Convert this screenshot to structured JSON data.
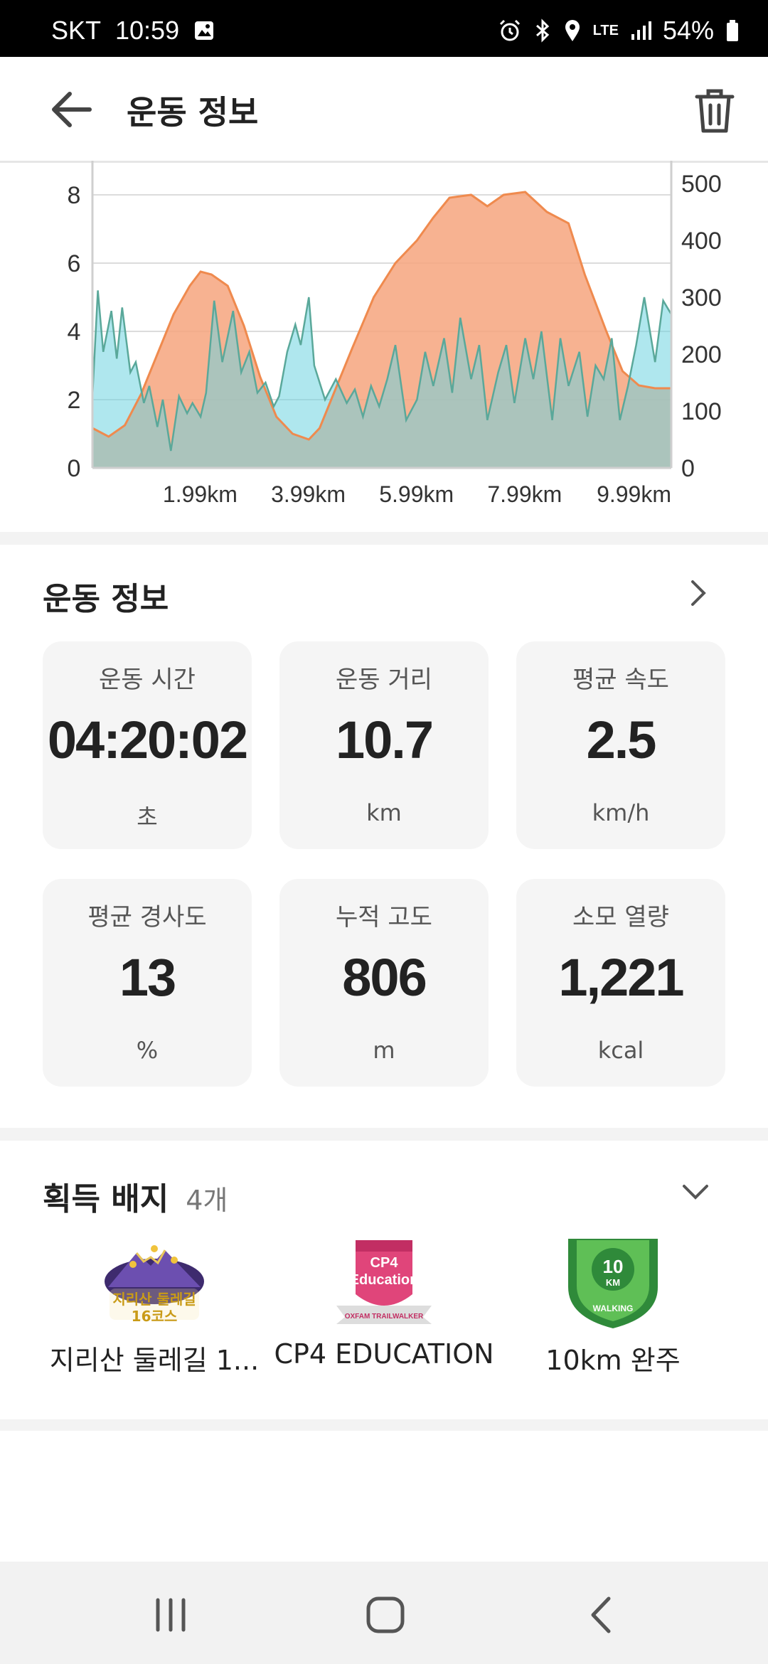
{
  "status": {
    "carrier": "SKT",
    "time": "10:59",
    "network": "LTE",
    "battery": "54%"
  },
  "header": {
    "title": "운동 정보"
  },
  "chart_data": {
    "type": "area",
    "x_tick_labels": [
      "1.99km",
      "3.99km",
      "5.99km",
      "7.99km",
      "9.99km"
    ],
    "x_range_km": [
      0,
      10.7
    ],
    "y_left": {
      "ticks": [
        0,
        2,
        4,
        6,
        8
      ],
      "range": [
        0,
        9
      ]
    },
    "y_right": {
      "ticks": [
        0,
        100,
        200,
        300,
        400,
        500
      ],
      "range": [
        0,
        540
      ]
    },
    "grid": true,
    "series": [
      {
        "axis": "right",
        "color": "#f6a57e",
        "x_km": [
          0,
          0.3,
          0.6,
          0.9,
          1.2,
          1.5,
          1.8,
          2.0,
          2.2,
          2.5,
          2.8,
          3.1,
          3.4,
          3.7,
          4.0,
          4.2,
          4.5,
          4.8,
          5.2,
          5.6,
          6.0,
          6.3,
          6.6,
          7.0,
          7.3,
          7.6,
          8.0,
          8.4,
          8.8,
          9.1,
          9.5,
          9.8,
          10.1,
          10.4,
          10.7
        ],
        "values": [
          70,
          55,
          75,
          130,
          200,
          270,
          320,
          345,
          340,
          320,
          250,
          160,
          90,
          60,
          50,
          70,
          140,
          210,
          300,
          360,
          400,
          440,
          475,
          480,
          460,
          480,
          485,
          450,
          430,
          340,
          240,
          170,
          145,
          140,
          140
        ]
      },
      {
        "axis": "left",
        "color": "#6ed4e0",
        "x_km": [
          0,
          0.1,
          0.2,
          0.35,
          0.45,
          0.55,
          0.7,
          0.8,
          0.95,
          1.05,
          1.2,
          1.3,
          1.45,
          1.6,
          1.75,
          1.85,
          2.0,
          2.1,
          2.25,
          2.4,
          2.6,
          2.75,
          2.9,
          3.05,
          3.2,
          3.35,
          3.45,
          3.6,
          3.75,
          3.85,
          4.0,
          4.1,
          4.3,
          4.5,
          4.7,
          4.85,
          5.0,
          5.15,
          5.3,
          5.45,
          5.6,
          5.8,
          6.0,
          6.15,
          6.3,
          6.5,
          6.65,
          6.8,
          7.0,
          7.15,
          7.3,
          7.5,
          7.65,
          7.8,
          8.0,
          8.15,
          8.3,
          8.5,
          8.65,
          8.8,
          9.0,
          9.15,
          9.3,
          9.45,
          9.6,
          9.75,
          9.9,
          10.05,
          10.2,
          10.4,
          10.55,
          10.7
        ],
        "values": [
          2.1,
          5.2,
          3.4,
          4.6,
          3.2,
          4.7,
          2.8,
          3.1,
          1.9,
          2.4,
          1.2,
          2.0,
          0.5,
          2.1,
          1.6,
          1.9,
          1.5,
          2.2,
          4.9,
          3.1,
          4.6,
          2.8,
          3.4,
          2.2,
          2.5,
          1.8,
          2.1,
          3.4,
          4.2,
          3.6,
          5.0,
          3.0,
          2.0,
          2.6,
          1.9,
          2.3,
          1.5,
          2.4,
          1.8,
          2.6,
          3.6,
          1.4,
          2.0,
          3.4,
          2.4,
          3.8,
          2.2,
          4.4,
          2.6,
          3.6,
          1.4,
          2.8,
          3.6,
          1.9,
          3.8,
          2.6,
          4.0,
          1.4,
          3.8,
          2.4,
          3.4,
          1.5,
          3.0,
          2.6,
          3.8,
          1.4,
          2.4,
          3.6,
          5.0,
          3.1,
          4.9,
          4.5
        ]
      }
    ]
  },
  "summary": {
    "title": "운동 정보",
    "cards": [
      {
        "label": "운동 시간",
        "value": "04:20:02",
        "unit": "초"
      },
      {
        "label": "운동 거리",
        "value": "10.7",
        "unit": "km"
      },
      {
        "label": "평균 속도",
        "value": "2.5",
        "unit": "km/h"
      },
      {
        "label": "평균 경사도",
        "value": "13",
        "unit": "%"
      },
      {
        "label": "누적 고도",
        "value": "806",
        "unit": "m"
      },
      {
        "label": "소모 열량",
        "value": "1,221",
        "unit": "kcal"
      }
    ]
  },
  "badges": {
    "title": "획득 배지",
    "count": "4개",
    "items": [
      {
        "name": "지리산 둘레길 1...",
        "art_text": [
          "지리산 둘레길",
          "16코스"
        ],
        "icon": "mountain-badge-icon"
      },
      {
        "name": "CP4 EDUCATION",
        "art_text": [
          "CP4",
          "Education",
          "OXFAM TRAILWALKER"
        ],
        "icon": "cp4-badge-icon"
      },
      {
        "name": "10km 완주",
        "art_text": [
          "10",
          "KM",
          "WALKING"
        ],
        "icon": "walking-badge-icon"
      }
    ]
  },
  "colors": {
    "elevation": "#f6a57e",
    "speed": "#6ed4e0",
    "overlap": "#c8c2a8"
  }
}
